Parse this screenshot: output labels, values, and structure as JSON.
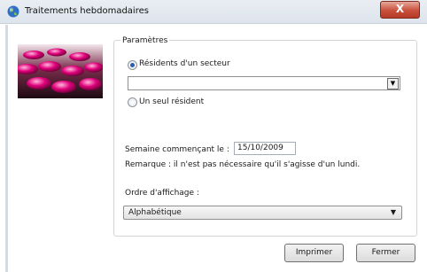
{
  "window": {
    "title": "Traitements hebdomadaires",
    "close_label": "X"
  },
  "params": {
    "legend": "Paramètres",
    "radio_sector_label": "Résidents d'un secteur",
    "sector_value": "",
    "radio_single_label": "Un seul résident",
    "week_label": "Semaine commençant le :",
    "week_value": "15/10/2009",
    "note": "Remarque : il n'est pas nécessaire qu'il s'agisse d'un lundi.",
    "order_label": "Ordre d'affichage :",
    "order_value": "Alphabétique"
  },
  "buttons": {
    "print": "Imprimer",
    "close": "Fermer"
  },
  "colors": {
    "accent": "#2a5db0",
    "close": "#c9503c",
    "pills": "#e0007a"
  },
  "icons": {
    "app": "globe-icon",
    "dropdown": "chevron-down-icon"
  }
}
